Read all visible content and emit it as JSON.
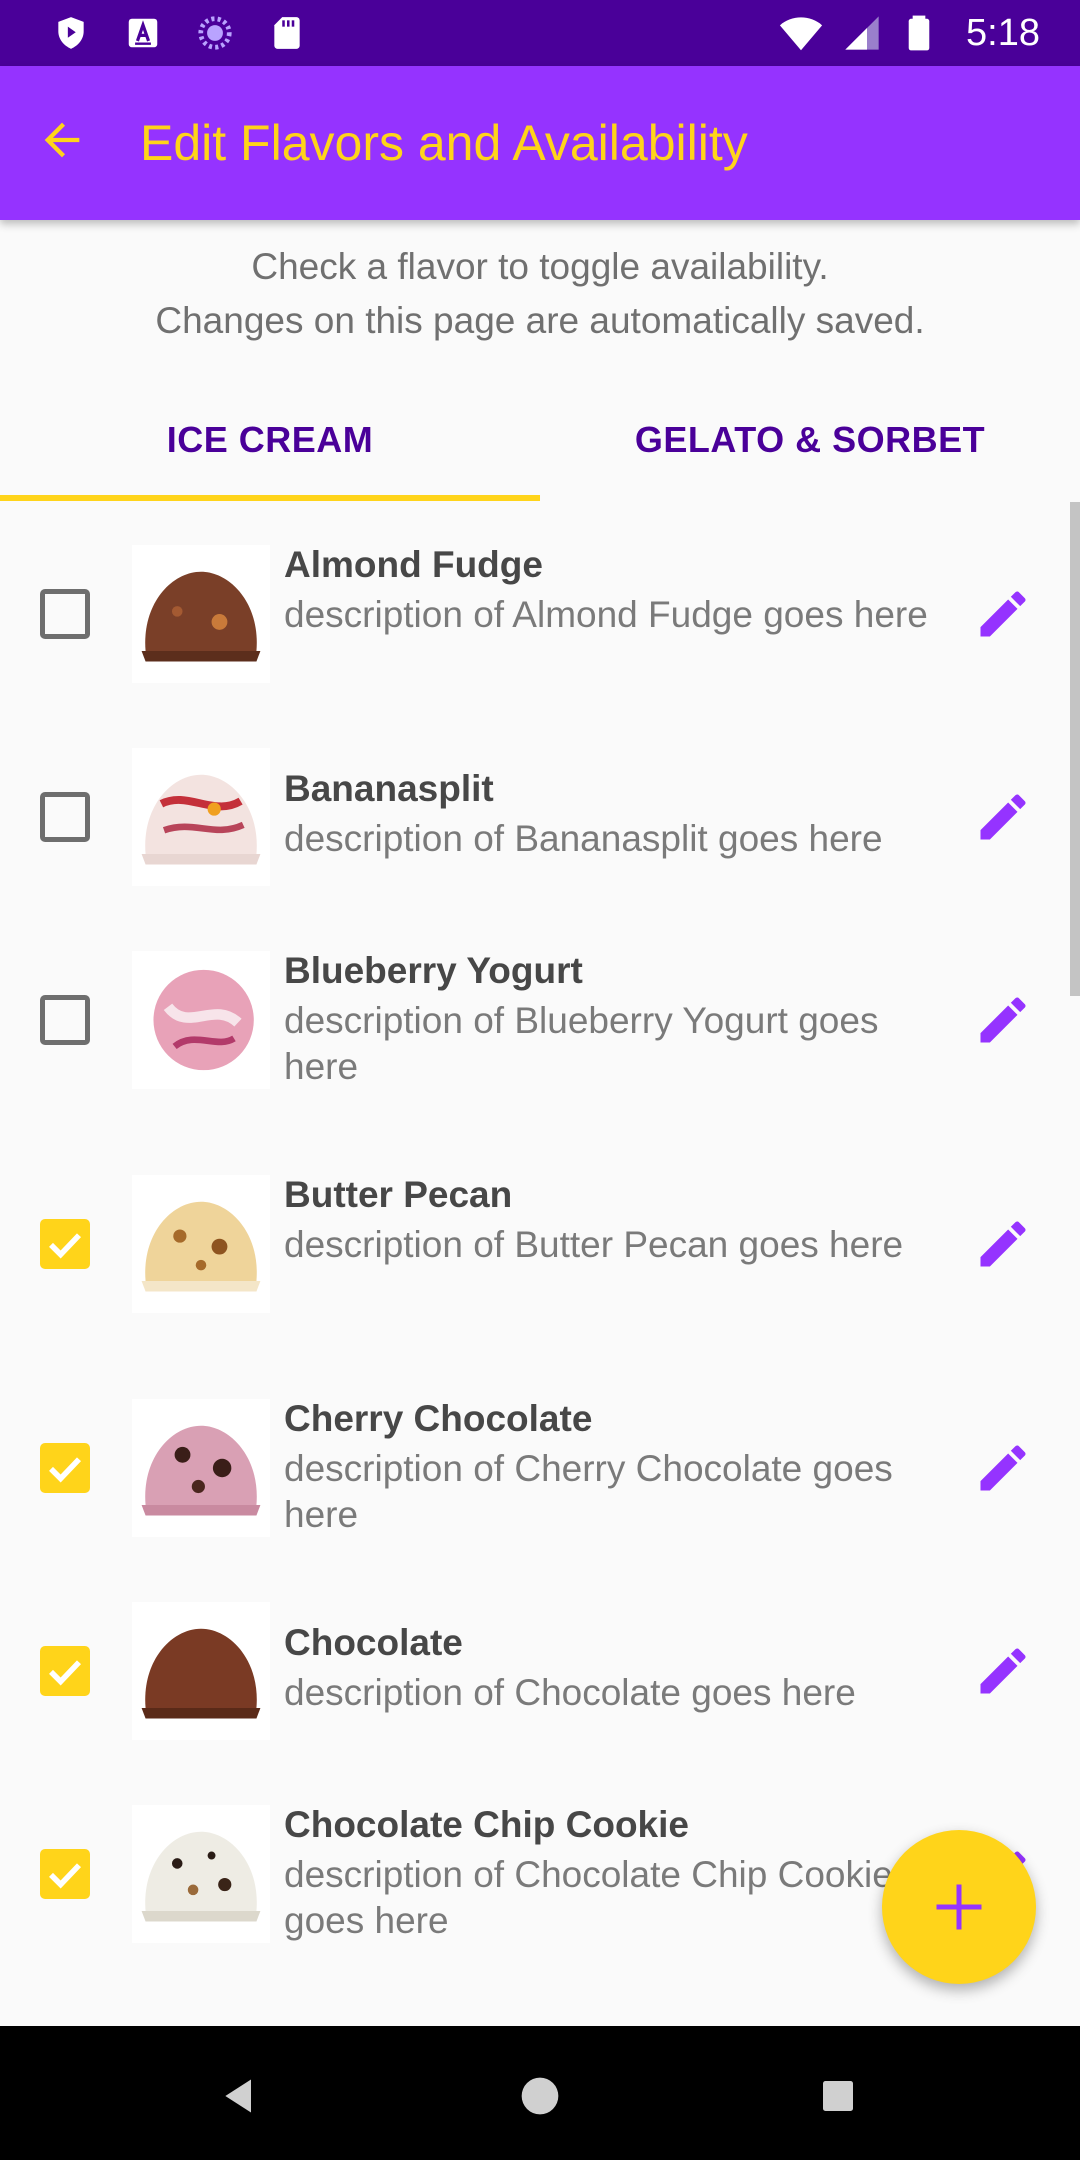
{
  "status_bar": {
    "time": "5:18",
    "left_icons": [
      "play-protect-icon",
      "accessibility-a-icon",
      "sync-circle-icon",
      "sd-card-icon"
    ],
    "right_icons": [
      "wifi-icon",
      "signal-icon",
      "battery-icon"
    ]
  },
  "app_bar": {
    "title": "Edit Flavors and Availability",
    "back_icon": "arrow-back-icon"
  },
  "instructions": {
    "line1": "Check a flavor to toggle availability.",
    "line2": "Changes on this page are automatically saved."
  },
  "tabs": [
    {
      "label": "ICE CREAM",
      "selected": true
    },
    {
      "label": "GELATO & SORBET",
      "selected": false
    }
  ],
  "flavors": [
    {
      "name": "Almond Fudge",
      "description": "description of Almond Fudge goes here",
      "available": false
    },
    {
      "name": "Bananasplit",
      "description": "description of Bananasplit goes here",
      "available": false
    },
    {
      "name": "Blueberry Yogurt",
      "description": "description of Blueberry Yogurt goes here",
      "available": false
    },
    {
      "name": "Butter Pecan",
      "description": "description of Butter Pecan goes here",
      "available": true
    },
    {
      "name": "Cherry Chocolate",
      "description": "description of Cherry Chocolate goes here",
      "available": true
    },
    {
      "name": "Chocolate",
      "description": "description of Chocolate goes here",
      "available": true
    },
    {
      "name": "Chocolate Chip Cookie",
      "description": "description of Chocolate Chip Cookie goes here",
      "available": true
    }
  ],
  "fab": {
    "icon": "plus-icon"
  },
  "colors": {
    "status_bar": "#4a0099",
    "app_bar": "#9533ff",
    "accent": "#ffd41a",
    "tab_text": "#4a0099",
    "edit_icon": "#9533ff"
  },
  "nav_bar": {
    "icons": [
      "back-triangle-icon",
      "home-circle-icon",
      "recents-square-icon"
    ]
  }
}
